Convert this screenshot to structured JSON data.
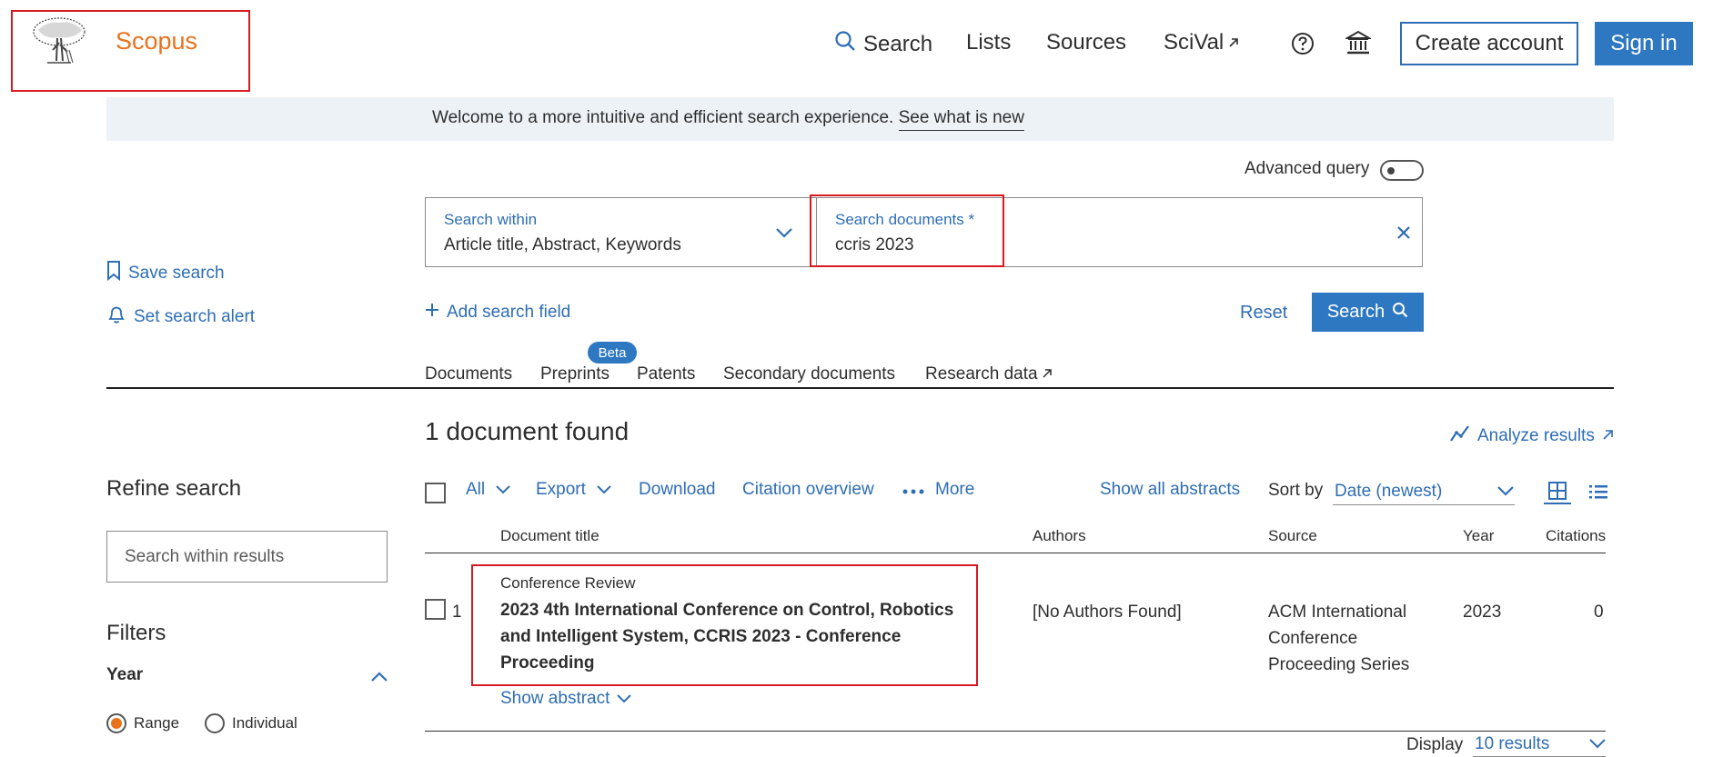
{
  "brand": {
    "name": "Scopus",
    "logo_icon": "elsevier-tree-icon"
  },
  "nav": {
    "search": "Search",
    "lists": "Lists",
    "sources": "Sources",
    "scival": "SciVal",
    "create_account": "Create account",
    "sign_in": "Sign in"
  },
  "banner": {
    "text": "Welcome to a more intuitive and efficient search experience.",
    "link": "See what is new"
  },
  "search_form": {
    "advanced_query_label": "Advanced query",
    "within_label": "Search within",
    "within_value": "Article title, Abstract, Keywords",
    "docs_label": "Search documents *",
    "docs_value": "ccris 2023",
    "add_field": "Add search field",
    "reset": "Reset",
    "search_button": "Search"
  },
  "side": {
    "save_search": "Save search",
    "set_alert": "Set search alert",
    "refine_title": "Refine search",
    "refine_placeholder": "Search within results",
    "filters_title": "Filters",
    "year_title": "Year",
    "range": "Range",
    "individual": "Individual"
  },
  "doc_tabs": [
    {
      "label": "Documents"
    },
    {
      "label": "Preprints"
    },
    {
      "label": "Patents"
    },
    {
      "label": "Secondary documents"
    },
    {
      "label": "Research data"
    }
  ],
  "beta_badge": "Beta",
  "results": {
    "count_text": "1 document found",
    "analyze": "Analyze results",
    "toolbar": {
      "all": "All",
      "export": "Export",
      "download": "Download",
      "citation_overview": "Citation overview",
      "more": "More",
      "show_all_abstracts": "Show all abstracts",
      "sort_by": "Sort by",
      "sort_value": "Date (newest)"
    },
    "columns": {
      "title": "Document title",
      "authors": "Authors",
      "source": "Source",
      "year": "Year",
      "citations": "Citations"
    },
    "rows": [
      {
        "index": "1",
        "type": "Conference Review",
        "title": "2023 4th International Conference on Control, Robotics and Intelligent System, CCRIS 2023 - Conference Proceeding",
        "authors": "[No Authors Found]",
        "source": "ACM International Conference Proceeding Series",
        "year": "2023",
        "citations": "0",
        "show_abstract": "Show abstract"
      }
    ],
    "display_label": "Display",
    "display_value": "10 results"
  }
}
